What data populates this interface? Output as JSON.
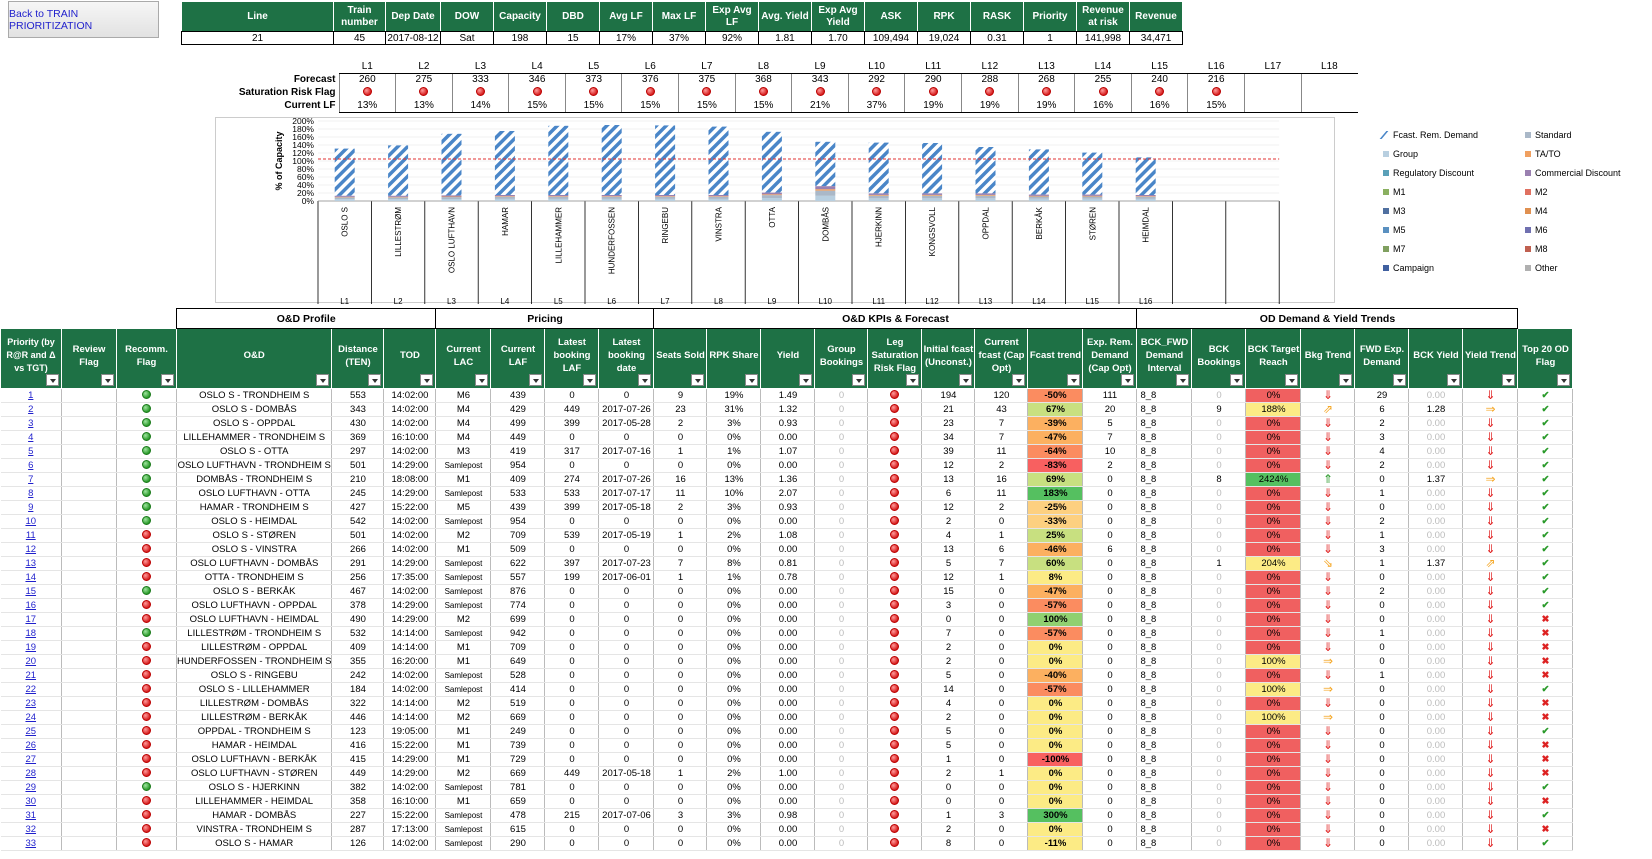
{
  "back_button": "Back to TRAIN PRIORITIZATION",
  "top": {
    "headers": [
      "Line",
      "Train number",
      "Dep Date",
      "DOW",
      "Capacity",
      "DBD",
      "Avg LF",
      "Max LF",
      "Exp Avg LF",
      "Avg. Yield",
      "Exp Avg Yield",
      "ASK",
      "RPK",
      "RASK",
      "Priority",
      "Revenue at risk",
      "Revenue"
    ],
    "values": [
      "21",
      "45",
      "2017-08-12",
      "Sat",
      "198",
      "15",
      "17%",
      "37%",
      "92%",
      "1.81",
      "1.70",
      "109,494",
      "19,024",
      "0.31",
      "1",
      "141,998",
      "34,471"
    ]
  },
  "legs": {
    "labels": [
      "L1",
      "L2",
      "L3",
      "L4",
      "L5",
      "L6",
      "L7",
      "L8",
      "L9",
      "L10",
      "L11",
      "L12",
      "L13",
      "L14",
      "L15",
      "L16",
      "L17",
      "L18"
    ],
    "forecast_label": "Forecast",
    "risk_label": "Saturation Risk Flag",
    "lf_label": "Current LF",
    "forecast": [
      "260",
      "275",
      "333",
      "346",
      "373",
      "376",
      "375",
      "368",
      "343",
      "292",
      "290",
      "288",
      "268",
      "255",
      "240",
      "216",
      "",
      ""
    ],
    "current_lf": [
      "13%",
      "13%",
      "14%",
      "15%",
      "15%",
      "15%",
      "15%",
      "15%",
      "21%",
      "37%",
      "19%",
      "19%",
      "19%",
      "16%",
      "16%",
      "15%",
      "",
      ""
    ],
    "risk": [
      1,
      1,
      1,
      1,
      1,
      1,
      1,
      1,
      1,
      1,
      1,
      1,
      1,
      1,
      1,
      1,
      0,
      0
    ]
  },
  "chart_data": {
    "type": "bar",
    "ylabel": "% of Capacity",
    "ylim": [
      0,
      200
    ],
    "yticks": [
      "0%",
      "20%",
      "40%",
      "60%",
      "80%",
      "100%",
      "120%",
      "140%",
      "160%",
      "180%",
      "200%"
    ],
    "categories": [
      "OSLO S",
      "LILLESTRØM",
      "OSLO LUFTHAVN",
      "HAMAR",
      "LILLEHAMMER",
      "HUNDERFOSSEN",
      "RINGEBU",
      "VINSTRA",
      "OTTA",
      "DOMBÅS",
      "HJERKINN",
      "KONGSVOLL",
      "OPPDAL",
      "BERKÅK",
      "STØREN",
      "HEIMDAL",
      "",
      ""
    ],
    "leg_labels": [
      "L1",
      "L2",
      "L3",
      "L4",
      "L5",
      "L6",
      "L7",
      "L8",
      "L9",
      "L10",
      "L11",
      "L12",
      "L13",
      "L14",
      "L15",
      "L16",
      "",
      ""
    ],
    "fcast_total": [
      131,
      139,
      168,
      175,
      188,
      190,
      189,
      186,
      173,
      148,
      146,
      145,
      135,
      129,
      121,
      109,
      0,
      0
    ],
    "booked": [
      13,
      13,
      14,
      15,
      15,
      15,
      15,
      15,
      21,
      37,
      19,
      19,
      19,
      16,
      16,
      15,
      0,
      0
    ],
    "threshold": 105,
    "series_names": [
      "Fcast. Rem. Demand",
      "Standard",
      "Group",
      "TA/TO",
      "Regulatory Discount",
      "Commercial Discount",
      "M1",
      "M2",
      "M3",
      "M4",
      "M5",
      "M6",
      "M7",
      "M8",
      "Campaign",
      "Other"
    ],
    "series_colors": [
      "#4a86c8",
      "#aab8c8",
      "#b8cfe0",
      "#f0a060",
      "#5aa0b8",
      "#9a80b0",
      "#8ab060",
      "#e07060",
      "#5070a0",
      "#e09050",
      "#5a90c0",
      "#7070b0",
      "#80a060",
      "#c06050",
      "#4060a0",
      "#b0b0b0"
    ]
  },
  "groups": {
    "od_profile": "O&D Profile",
    "pricing": "Pricing",
    "kpis": "O&D KPIs & Forecast",
    "trends": "OD Demand & Yield Trends"
  },
  "columns": [
    "Priority (by R@R and Δ vs TGT)",
    "Review Flag",
    "Recomm. Flag",
    "O&D",
    "Distance (TEN)",
    "TOD",
    "Current LAC",
    "Current LAF",
    "Latest booking LAF",
    "Latest booking date",
    "Seats Sold",
    "RPK Share",
    "Yield",
    "Group Bookings",
    "Leg Saturation Risk Flag",
    "Initial fcast (Unconst.)",
    "Current fcast (Cap Opt)",
    "Fcast trend",
    "Exp. Rem. Demand (Cap Opt)",
    "BCK_FWD Demand Interval",
    "BCK Bookings",
    "BCK Target Reach",
    "Bkg Trend",
    "FWD Exp. Demand",
    "BCK Yield",
    "Yield Trend",
    "Top 20 OD Flag"
  ],
  "rows": [
    [
      "1",
      "g",
      "OSLO S - TRONDHEIM S",
      "553",
      "14:02:00",
      "M6",
      "439",
      "0",
      "0",
      "9",
      "19%",
      "1.49",
      "0",
      "194",
      "120",
      "-50%",
      "111",
      "8_8",
      "0",
      "0%",
      "d",
      "29",
      "0.00",
      "d",
      "c"
    ],
    [
      "2",
      "g",
      "OSLO S - DOMBÅS",
      "343",
      "14:02:00",
      "M4",
      "429",
      "449",
      "2017-07-26",
      "23",
      "31%",
      "1.32",
      "0",
      "21",
      "43",
      "67%",
      "20",
      "8_8",
      "9",
      "188%",
      "ur",
      "6",
      "1.28",
      "r",
      "c"
    ],
    [
      "3",
      "g",
      "OSLO S - OPPDAL",
      "430",
      "14:02:00",
      "M4",
      "499",
      "399",
      "2017-05-28",
      "2",
      "3%",
      "0.93",
      "0",
      "23",
      "7",
      "-39%",
      "5",
      "8_8",
      "0",
      "0%",
      "d",
      "2",
      "0.00",
      "d",
      "c"
    ],
    [
      "4",
      "g",
      "LILLEHAMMER - TRONDHEIM S",
      "369",
      "16:10:00",
      "M4",
      "449",
      "0",
      "0",
      "0",
      "0%",
      "0.00",
      "0",
      "34",
      "7",
      "-47%",
      "7",
      "8_8",
      "0",
      "0%",
      "d",
      "3",
      "0.00",
      "d",
      "c"
    ],
    [
      "5",
      "g",
      "OSLO S - OTTA",
      "297",
      "14:02:00",
      "M3",
      "419",
      "317",
      "2017-07-16",
      "1",
      "1%",
      "1.07",
      "0",
      "39",
      "11",
      "-64%",
      "10",
      "8_8",
      "0",
      "0%",
      "d",
      "4",
      "0.00",
      "d",
      "c"
    ],
    [
      "6",
      "g",
      "OSLO LUFTHAVN - TRONDHEIM S",
      "501",
      "14:29:00",
      "Samlepost",
      "954",
      "0",
      "0",
      "0",
      "0%",
      "0.00",
      "0",
      "12",
      "2",
      "-83%",
      "2",
      "8_8",
      "0",
      "0%",
      "d",
      "2",
      "0.00",
      "d",
      "c"
    ],
    [
      "7",
      "g",
      "DOMBÅS - TRONDHEIM S",
      "210",
      "18:08:00",
      "M1",
      "409",
      "274",
      "2017-07-26",
      "16",
      "13%",
      "1.36",
      "0",
      "13",
      "16",
      "69%",
      "0",
      "8_8",
      "8",
      "2424%",
      "u",
      "0",
      "1.37",
      "r",
      "c"
    ],
    [
      "8",
      "g",
      "OSLO LUFTHAVN - OTTA",
      "245",
      "14:29:00",
      "Samlepost",
      "533",
      "533",
      "2017-07-17",
      "11",
      "10%",
      "2.07",
      "0",
      "6",
      "11",
      "183%",
      "0",
      "8_8",
      "0",
      "0%",
      "d",
      "1",
      "0.00",
      "d",
      "c"
    ],
    [
      "9",
      "g",
      "HAMAR - TRONDHEIM S",
      "427",
      "15:22:00",
      "M5",
      "439",
      "399",
      "2017-05-18",
      "2",
      "3%",
      "0.93",
      "0",
      "12",
      "2",
      "-25%",
      "0",
      "8_8",
      "0",
      "0%",
      "d",
      "0",
      "0.00",
      "d",
      "c"
    ],
    [
      "10",
      "g",
      "OSLO S - HEIMDAL",
      "542",
      "14:02:00",
      "Samlepost",
      "954",
      "0",
      "0",
      "0",
      "0%",
      "0.00",
      "0",
      "2",
      "0",
      "-33%",
      "0",
      "8_8",
      "0",
      "0%",
      "d",
      "2",
      "0.00",
      "d",
      "c"
    ],
    [
      "11",
      "r",
      "OSLO S - STØREN",
      "501",
      "14:02:00",
      "M2",
      "709",
      "539",
      "2017-05-19",
      "1",
      "2%",
      "1.08",
      "0",
      "4",
      "1",
      "25%",
      "0",
      "8_8",
      "0",
      "0%",
      "d",
      "1",
      "0.00",
      "d",
      "c"
    ],
    [
      "12",
      "r",
      "OSLO S - VINSTRA",
      "266",
      "14:02:00",
      "M1",
      "509",
      "0",
      "0",
      "0",
      "0%",
      "0.00",
      "0",
      "13",
      "6",
      "-46%",
      "6",
      "8_8",
      "0",
      "0%",
      "d",
      "3",
      "0.00",
      "d",
      "c"
    ],
    [
      "13",
      "r",
      "OSLO LUFTHAVN - DOMBÅS",
      "291",
      "14:29:00",
      "Samlepost",
      "622",
      "397",
      "2017-07-23",
      "7",
      "8%",
      "0.81",
      "0",
      "5",
      "7",
      "60%",
      "0",
      "8_8",
      "1",
      "204%",
      "dr",
      "1",
      "1.37",
      "ur",
      "c"
    ],
    [
      "14",
      "r",
      "OTTA - TRONDHEIM S",
      "256",
      "17:35:00",
      "Samlepost",
      "557",
      "199",
      "2017-06-01",
      "1",
      "1%",
      "0.78",
      "0",
      "12",
      "1",
      "8%",
      "0",
      "8_8",
      "0",
      "0%",
      "d",
      "0",
      "0.00",
      "d",
      "c"
    ],
    [
      "15",
      "g",
      "OSLO S - BERKÅK",
      "467",
      "14:02:00",
      "Samlepost",
      "876",
      "0",
      "0",
      "0",
      "0%",
      "0.00",
      "0",
      "15",
      "0",
      "-47%",
      "0",
      "8_8",
      "0",
      "0%",
      "d",
      "2",
      "0.00",
      "d",
      "c"
    ],
    [
      "16",
      "r",
      "OSLO LUFTHAVN - OPPDAL",
      "378",
      "14:29:00",
      "Samlepost",
      "774",
      "0",
      "0",
      "0",
      "0%",
      "0.00",
      "0",
      "3",
      "0",
      "-57%",
      "0",
      "8_8",
      "0",
      "0%",
      "d",
      "0",
      "0.00",
      "d",
      "c"
    ],
    [
      "17",
      "r",
      "OSLO LUFTHAVN - HEIMDAL",
      "490",
      "14:29:00",
      "M2",
      "699",
      "0",
      "0",
      "0",
      "0%",
      "0.00",
      "0",
      "0",
      "0",
      "100%",
      "0",
      "8_8",
      "0",
      "0%",
      "d",
      "0",
      "0.00",
      "d",
      "x"
    ],
    [
      "18",
      "g",
      "LILLESTRØM - TRONDHEIM S",
      "532",
      "14:14:00",
      "Samlepost",
      "942",
      "0",
      "0",
      "0",
      "0%",
      "0.00",
      "0",
      "7",
      "0",
      "-57%",
      "0",
      "8_8",
      "0",
      "0%",
      "d",
      "1",
      "0.00",
      "d",
      "x"
    ],
    [
      "19",
      "r",
      "LILLESTRØM - OPPDAL",
      "409",
      "14:14:00",
      "M1",
      "709",
      "0",
      "0",
      "0",
      "0%",
      "0.00",
      "0",
      "2",
      "0",
      "0%",
      "0",
      "8_8",
      "0",
      "0%",
      "d",
      "0",
      "0.00",
      "d",
      "x"
    ],
    [
      "20",
      "r",
      "HUNDERFOSSEN - TRONDHEIM S",
      "355",
      "16:20:00",
      "M1",
      "649",
      "0",
      "0",
      "0",
      "0%",
      "0.00",
      "0",
      "2",
      "0",
      "0%",
      "0",
      "8_8",
      "0",
      "100%",
      "r",
      "0",
      "0.00",
      "d",
      "x"
    ],
    [
      "21",
      "r",
      "OSLO S - RINGEBU",
      "242",
      "14:02:00",
      "Samlepost",
      "528",
      "0",
      "0",
      "0",
      "0%",
      "0.00",
      "0",
      "5",
      "0",
      "-40%",
      "0",
      "8_8",
      "0",
      "0%",
      "d",
      "1",
      "0.00",
      "d",
      "x"
    ],
    [
      "22",
      "r",
      "OSLO S - LILLEHAMMER",
      "184",
      "14:02:00",
      "Samlepost",
      "414",
      "0",
      "0",
      "0",
      "0%",
      "0.00",
      "0",
      "14",
      "0",
      "-57%",
      "0",
      "8_8",
      "0",
      "100%",
      "r",
      "0",
      "0.00",
      "d",
      "c"
    ],
    [
      "23",
      "r",
      "LILLESTRØM - DOMBÅS",
      "322",
      "14:14:00",
      "M2",
      "519",
      "0",
      "0",
      "0",
      "0%",
      "0.00",
      "0",
      "4",
      "0",
      "0%",
      "0",
      "8_8",
      "0",
      "0%",
      "d",
      "0",
      "0.00",
      "d",
      "x"
    ],
    [
      "24",
      "r",
      "LILLESTRØM - BERKÅK",
      "446",
      "14:14:00",
      "M2",
      "669",
      "0",
      "0",
      "0",
      "0%",
      "0.00",
      "0",
      "2",
      "0",
      "0%",
      "0",
      "8_8",
      "0",
      "100%",
      "r",
      "0",
      "0.00",
      "d",
      "x"
    ],
    [
      "25",
      "r",
      "OPPDAL - TRONDHEIM S",
      "123",
      "19:05:00",
      "M1",
      "249",
      "0",
      "0",
      "0",
      "0%",
      "0.00",
      "0",
      "5",
      "0",
      "0%",
      "0",
      "8_8",
      "0",
      "0%",
      "d",
      "0",
      "0.00",
      "d",
      "c"
    ],
    [
      "26",
      "r",
      "HAMAR - HEIMDAL",
      "416",
      "15:22:00",
      "M1",
      "739",
      "0",
      "0",
      "0",
      "0%",
      "0.00",
      "0",
      "5",
      "0",
      "0%",
      "0",
      "8_8",
      "0",
      "0%",
      "d",
      "0",
      "0.00",
      "d",
      "x"
    ],
    [
      "27",
      "r",
      "OSLO LUFTHAVN - BERKÅK",
      "415",
      "14:29:00",
      "M1",
      "729",
      "0",
      "0",
      "0",
      "0%",
      "0.00",
      "0",
      "1",
      "0",
      "-100%",
      "0",
      "8_8",
      "0",
      "0%",
      "d",
      "0",
      "0.00",
      "d",
      "x"
    ],
    [
      "28",
      "r",
      "OSLO LUFTHAVN - STØREN",
      "449",
      "14:29:00",
      "M2",
      "669",
      "449",
      "2017-05-18",
      "1",
      "2%",
      "1.00",
      "0",
      "2",
      "1",
      "0%",
      "0",
      "8_8",
      "0",
      "0%",
      "d",
      "0",
      "0.00",
      "d",
      "x"
    ],
    [
      "29",
      "g",
      "OSLO S - HJERKINN",
      "382",
      "14:02:00",
      "Samlepost",
      "781",
      "0",
      "0",
      "0",
      "0%",
      "0.00",
      "0",
      "0",
      "0",
      "0%",
      "0",
      "8_8",
      "0",
      "0%",
      "d",
      "0",
      "0.00",
      "d",
      "c"
    ],
    [
      "30",
      "r",
      "LILLEHAMMER - HEIMDAL",
      "358",
      "16:10:00",
      "M1",
      "659",
      "0",
      "0",
      "0",
      "0%",
      "0.00",
      "0",
      "0",
      "0",
      "0%",
      "0",
      "8_8",
      "0",
      "0%",
      "d",
      "0",
      "0.00",
      "d",
      "x"
    ],
    [
      "31",
      "r",
      "HAMAR - DOMBÅS",
      "227",
      "15:22:00",
      "Samlepost",
      "478",
      "215",
      "2017-07-06",
      "3",
      "3%",
      "0.98",
      "0",
      "1",
      "3",
      "300%",
      "0",
      "8_8",
      "0",
      "0%",
      "d",
      "0",
      "0.00",
      "d",
      "c"
    ],
    [
      "32",
      "r",
      "VINSTRA - TRONDHEIM S",
      "287",
      "17:13:00",
      "Samlepost",
      "615",
      "0",
      "0",
      "0",
      "0%",
      "0.00",
      "0",
      "2",
      "0",
      "0%",
      "0",
      "8_8",
      "0",
      "0%",
      "d",
      "0",
      "0.00",
      "d",
      "x"
    ],
    [
      "33",
      "r",
      "OSLO S - HAMAR",
      "126",
      "14:02:00",
      "Samlepost",
      "290",
      "0",
      "0",
      "0",
      "0%",
      "0.00",
      "0",
      "8",
      "0",
      "-11%",
      "0",
      "8_8",
      "0",
      "0%",
      "d",
      "0",
      "0.00",
      "d",
      "c"
    ]
  ]
}
